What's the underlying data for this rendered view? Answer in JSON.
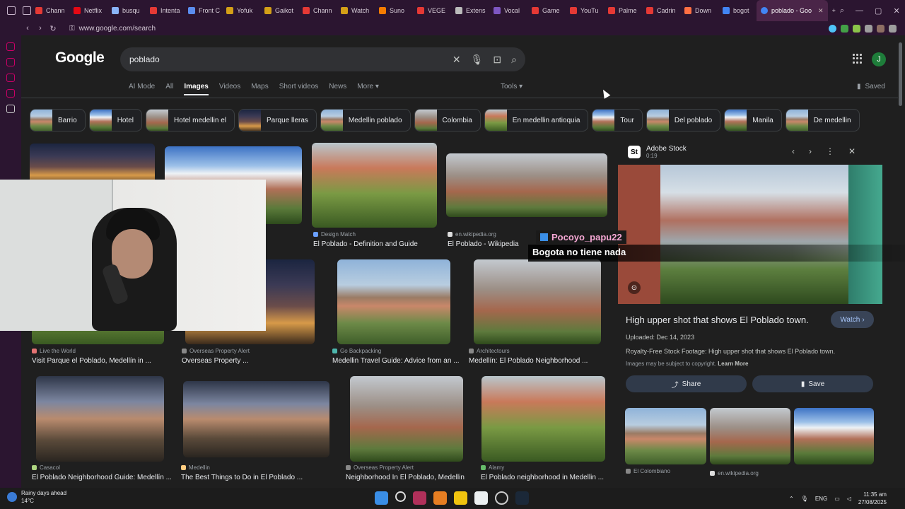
{
  "browser": {
    "tabs": [
      {
        "label": "Chann",
        "color": "#e53935"
      },
      {
        "label": "Netflix",
        "color": "#e50914"
      },
      {
        "label": "busqu",
        "color": "#8ab4f8"
      },
      {
        "label": "Intenta",
        "color": "#e53935"
      },
      {
        "label": "Front C",
        "color": "#5b8def"
      },
      {
        "label": "Yofuk",
        "color": "#d4a017"
      },
      {
        "label": "Gaikot",
        "color": "#d4a017"
      },
      {
        "label": "Chann",
        "color": "#e53935"
      },
      {
        "label": "Watch",
        "color": "#d4a017"
      },
      {
        "label": "Suno",
        "color": "#f57c00"
      },
      {
        "label": "VEGE",
        "color": "#e53935"
      },
      {
        "label": "Extens",
        "color": "#bbbbbb"
      },
      {
        "label": "Vocal",
        "color": "#7e57c2"
      },
      {
        "label": "Game",
        "color": "#e53935"
      },
      {
        "label": "YouTu",
        "color": "#e53935"
      },
      {
        "label": "Palme",
        "color": "#e53935"
      },
      {
        "label": "Cadrin",
        "color": "#e53935"
      },
      {
        "label": "Down",
        "color": "#ff7043"
      },
      {
        "label": "bogot",
        "color": "#4285f4"
      }
    ],
    "active_tab": "poblado - Goo",
    "url": "www.google.com/search"
  },
  "google": {
    "logo": "Google",
    "query": "poblado",
    "avatar_letter": "J",
    "filters": [
      "AI Mode",
      "All",
      "Images",
      "Videos",
      "Maps",
      "Short videos",
      "News",
      "More ▾"
    ],
    "active_filter": "Images",
    "tools": "Tools ▾",
    "saved": "Saved",
    "chips": [
      "Barrio",
      "Hotel",
      "Hotel medellin el",
      "Parque lleras",
      "Medellin poblado",
      "Colombia",
      "En medellin antioquia",
      "Tour",
      "Del poblado",
      "Manila",
      "De medellin"
    ]
  },
  "results": {
    "r1": {
      "source": "Design Match",
      "title": "El Poblado - Definition and Guide"
    },
    "r2": {
      "source": "en.wikipedia.org",
      "title": "El Poblado - Wikipedia"
    },
    "r3": {
      "source": "Live the World",
      "title": "Visit Parque el Poblado, Medellín in ..."
    },
    "r4": {
      "source": "Overseas Property Alert",
      "title": "Overseas Property ..."
    },
    "r5": {
      "source": "Go Backpacking",
      "title": "Medellin Travel Guide: Advice from an ..."
    },
    "r6": {
      "source": "Architectours",
      "title": "Medellín: El Poblado Neighborhood ..."
    },
    "r7": {
      "source": "Casacol",
      "title": "El Poblado Neighborhood Guide: Medellín ..."
    },
    "r8": {
      "source": "Medellin",
      "title": "The Best Things to Do in El Poblado ..."
    },
    "r9": {
      "source": "Overseas Property Alert",
      "title": "Neighborhood In El Poblado, Medellin"
    },
    "r10": {
      "source": "Alamy",
      "title": "El Poblado neighborhood in Medellin ..."
    }
  },
  "stream": {
    "username": "Pocoyo_papu22",
    "message": "Bogota no tiene nada"
  },
  "panel": {
    "provider": "Adobe Stock",
    "duration": "0:19",
    "title": "High upper shot that shows El Poblado town.",
    "watch": "Watch",
    "uploaded": "Uploaded: Dec 14, 2023",
    "description": "Royalty-Free Stock Footage: High upper shot that shows El Poblado town.",
    "copyright": "Images may be subject to copyright.",
    "learn_more": "Learn More",
    "share": "Share",
    "save": "Save",
    "related": [
      "El Colombiano",
      "en.wikipedia.org"
    ]
  },
  "taskbar": {
    "weather_title": "Rainy days ahead",
    "weather_temp": "14°C",
    "lang": "ENG",
    "time": "11:35 am",
    "date": "27/08/2025"
  }
}
